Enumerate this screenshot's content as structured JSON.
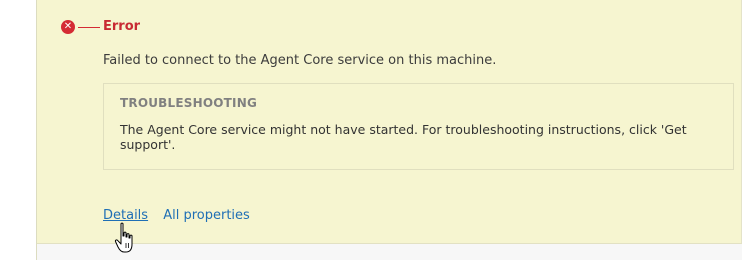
{
  "error": {
    "icon": "error-x-icon",
    "title": "Error",
    "message": "Failed to connect to the Agent Core service on this machine.",
    "color": "#d42b34"
  },
  "troubleshooting": {
    "title": "TROUBLESHOOTING",
    "text": "The Agent Core service might not have started. For troubleshooting instructions, click 'Get support'."
  },
  "links": {
    "details": "Details",
    "all_properties": "All properties",
    "color": "#1f6fb5"
  },
  "colors": {
    "panel_background": "#f6f5d0",
    "error_red": "#d42b34"
  },
  "cursor": "hand-pointer-icon"
}
